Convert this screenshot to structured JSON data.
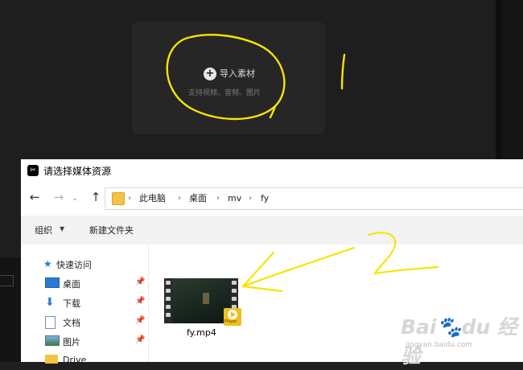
{
  "editor": {
    "import_icon": "+",
    "import_label": "导入素材",
    "import_hint": "支持视频、音频、图片"
  },
  "dialog": {
    "title": "请选择媒体资源",
    "app_icon": "capcut-icon",
    "nav": {
      "back": "←",
      "forward": "→",
      "up": "↑"
    },
    "breadcrumb": [
      "此电脑",
      "桌面",
      "mv",
      "fy"
    ],
    "toolbar": {
      "organize": "组织",
      "new_folder": "新建文件夹"
    },
    "sidebar": {
      "quick_access": "快速访问",
      "items": [
        {
          "label": "桌面",
          "icon": "desktop-icon"
        },
        {
          "label": "下载",
          "icon": "download-icon"
        },
        {
          "label": "文档",
          "icon": "document-icon"
        },
        {
          "label": "图片",
          "icon": "pictures-icon"
        },
        {
          "label": "Drive",
          "icon": "folder-icon"
        }
      ]
    },
    "files": [
      {
        "name": "fy.mp4",
        "badge": "Player"
      }
    ]
  },
  "watermark": {
    "text": "Bai du 经验",
    "url": "jingyan.baidu.com"
  },
  "colors": {
    "annotation": "#f5e600",
    "folder": "#f5c242",
    "accent": "#2d7ad6"
  }
}
